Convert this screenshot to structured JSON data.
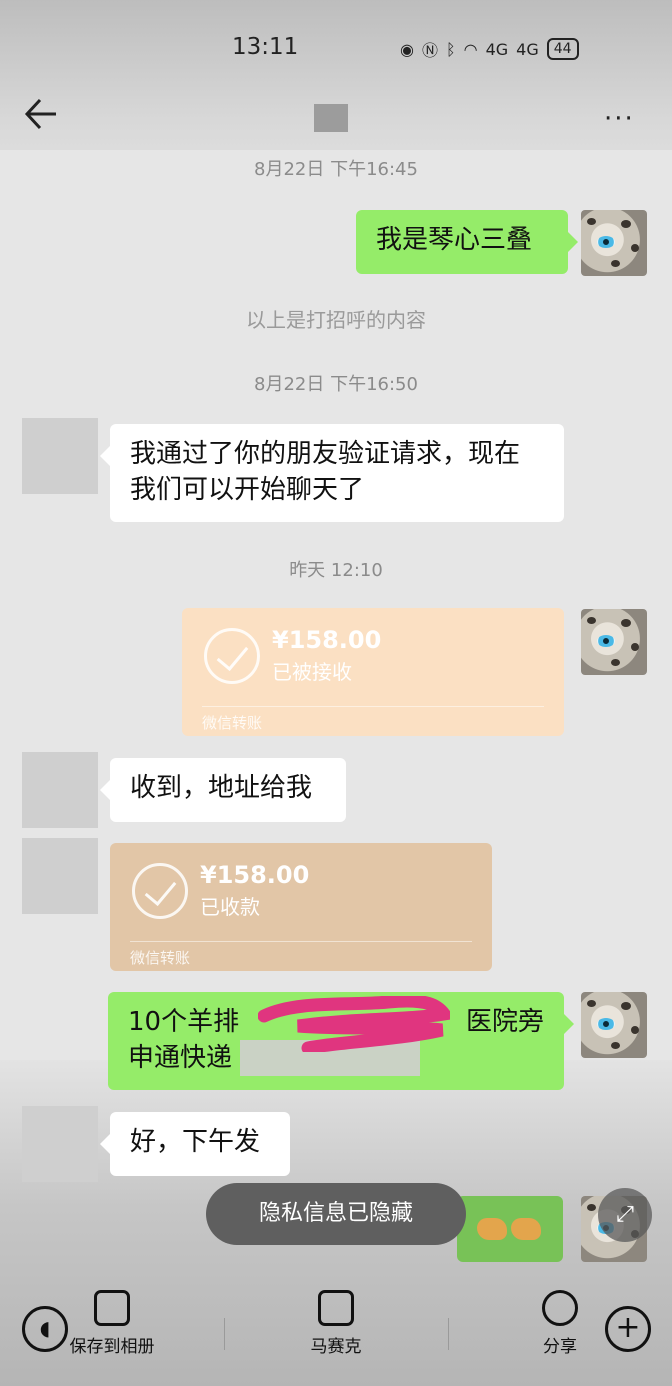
{
  "status": {
    "time": "13:11",
    "signal1": "4G",
    "signal2": "4G",
    "battery": "44"
  },
  "nav": {
    "more": "···"
  },
  "messages": {
    "ts1": "8月22日 下午16:45",
    "me1": "我是琴心三叠",
    "sys1": "以上是打招呼的内容",
    "ts2": "8月22日 下午16:50",
    "them1": "我通过了你的朋友验证请求，现在我们可以开始聊天了",
    "ts3": "昨天 12:10",
    "transfer1": {
      "amount": "¥158.00",
      "status": "已被接收",
      "label": "微信转账"
    },
    "them2": "收到，地址给我",
    "transfer2": {
      "amount": "¥158.00",
      "status": "已收款",
      "label": "微信转账"
    },
    "me2_line1": "10个羊排",
    "me2_line1_end": "医院旁",
    "me2_line2": "申通快递",
    "them3": "好，下午发"
  },
  "toast": "隐私信息已隐藏",
  "toolbar": {
    "save": "保存到相册",
    "mosaic": "马赛克",
    "share": "分享"
  },
  "colors": {
    "green_bubble": "#95ec69",
    "transfer_sent": "#fbe0c3",
    "transfer_recv": "#e2c6a7"
  }
}
